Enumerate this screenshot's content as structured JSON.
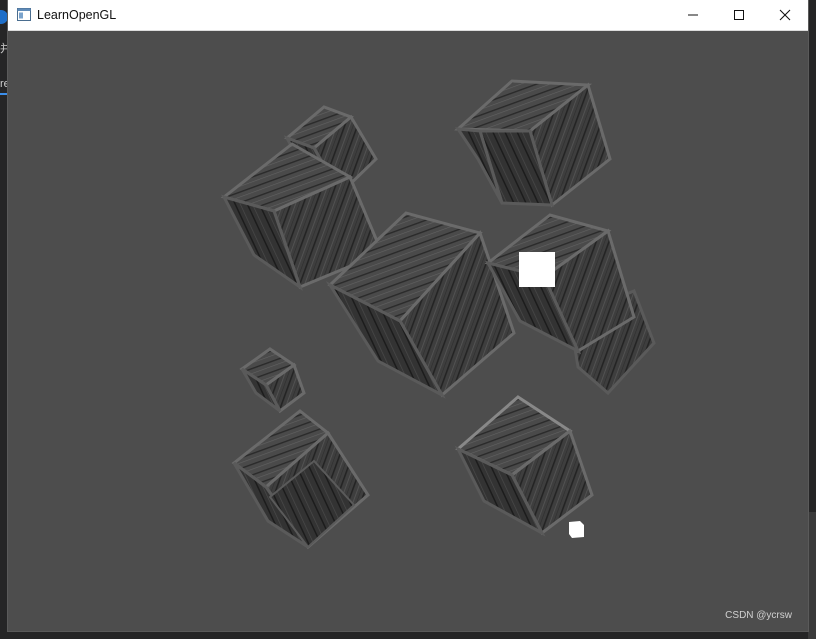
{
  "window": {
    "title": "LearnOpenGL",
    "controls": {
      "minimize": "minimize",
      "maximize": "maximize",
      "close": "close"
    },
    "icons": {
      "app": "window-app-icon"
    }
  },
  "background_edges": {
    "text_top": "并",
    "text_mid": "re"
  },
  "scene": {
    "clear_color": "#4d4d4d",
    "light_color": "#ffffff",
    "crate_count": 10,
    "light_count": 2
  },
  "watermark": "CSDN @ycrsw"
}
